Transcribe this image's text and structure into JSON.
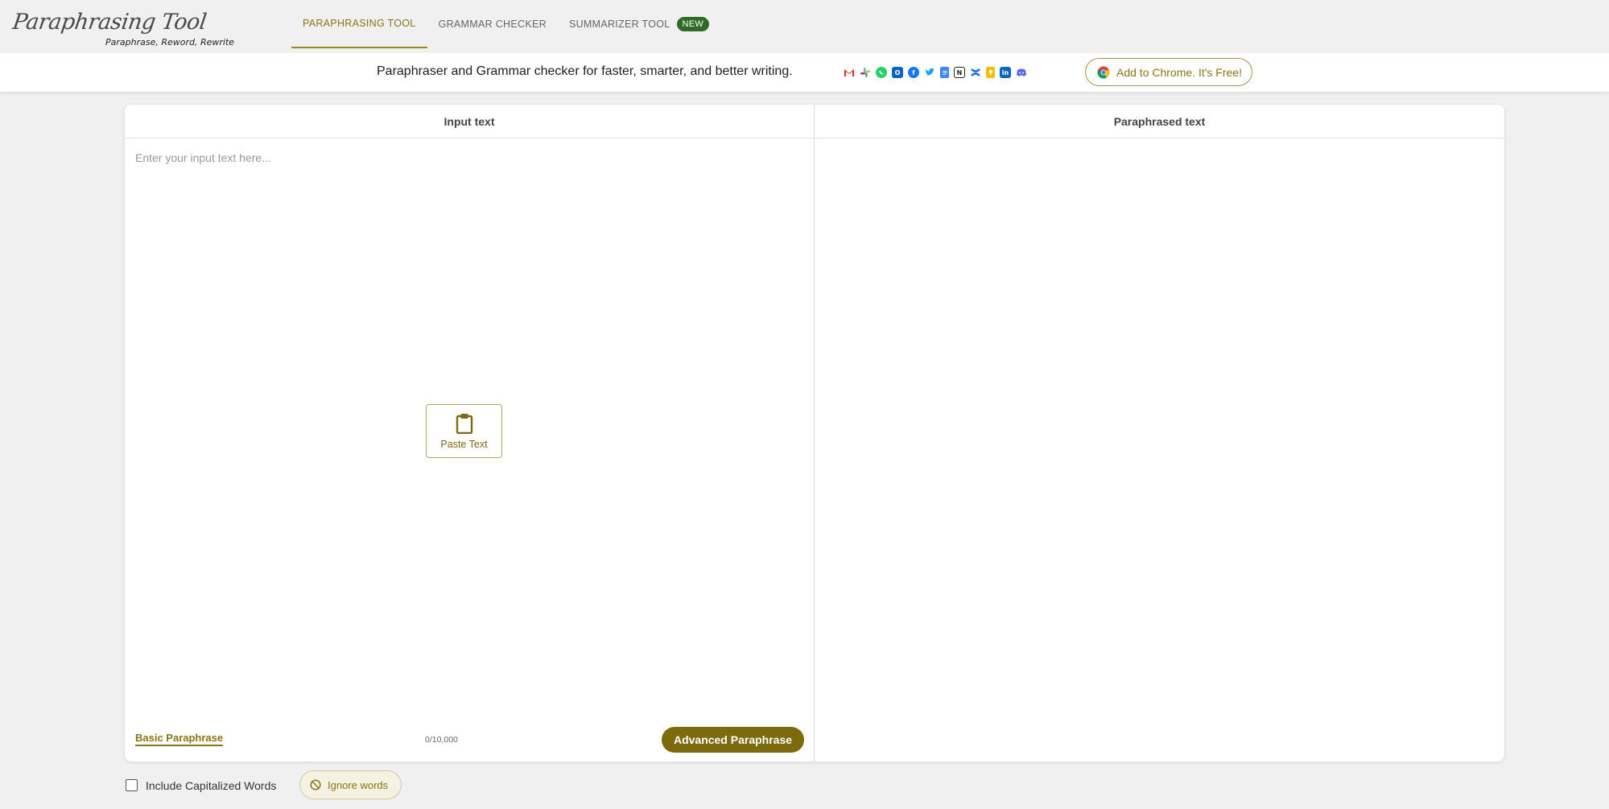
{
  "logo": {
    "script_text": "Paraphrasing Tool",
    "tagline": "Paraphrase, Reword, Rewrite"
  },
  "nav": {
    "items": [
      {
        "label": "PARAPHRASING TOOL",
        "active": true
      },
      {
        "label": "GRAMMAR CHECKER",
        "active": false
      },
      {
        "label": "SUMMARIZER TOOL",
        "active": false,
        "badge": "NEW"
      }
    ]
  },
  "banner": {
    "text": "Paraphraser and Grammar checker for faster, smarter, and better writing.",
    "integration_icons": [
      "gmail-icon",
      "slack-icon",
      "whatsapp-icon",
      "outlook-icon",
      "facebook-icon",
      "twitter-icon",
      "google-docs-icon",
      "notion-icon",
      "confluence-icon",
      "google-keep-icon",
      "linkedin-icon",
      "discord-icon"
    ],
    "chrome_button": "Add to Chrome. It's Free!"
  },
  "editor": {
    "input_header": "Input text",
    "output_header": "Paraphrased text",
    "input_placeholder": "Enter your input text here...",
    "input_value": "",
    "paste_label": "Paste Text",
    "basic_label": "Basic Paraphrase",
    "counter": "0/10,000",
    "advanced_label": "Advanced Paraphrase"
  },
  "options": {
    "include_capitalized_label": "Include Capitalized Words",
    "include_capitalized_checked": false,
    "ignore_words_label": "Ignore words"
  },
  "colors": {
    "accent": "#8a7516",
    "accent_dark": "#7c6a0c",
    "badge_green": "#2e6b27",
    "background": "#f0f0f0"
  }
}
